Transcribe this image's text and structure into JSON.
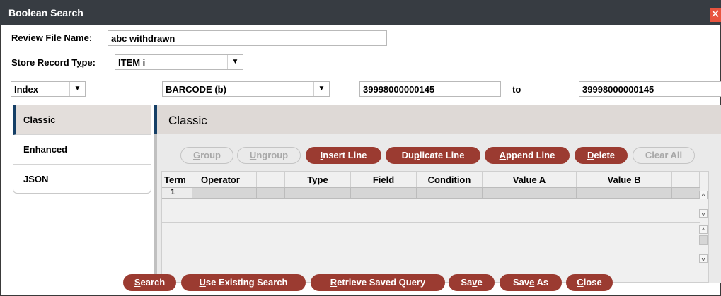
{
  "window": {
    "title": "Boolean Search",
    "close_glyph": "✕"
  },
  "review_file": {
    "label_prefix": "Revi",
    "label_mnemonic": "e",
    "label_suffix": "w File Name:",
    "value": "abc withdrawn"
  },
  "store_record": {
    "label_prefix": "Store Record T",
    "label_mnemonic": "y",
    "label_suffix": "pe:",
    "value": "ITEM i"
  },
  "index_select": {
    "value": "Index"
  },
  "field_select": {
    "value": "BARCODE  (b)"
  },
  "range": {
    "from": "39998000000145",
    "to_label": "to",
    "to": "39998000000145"
  },
  "tabs": [
    {
      "label": "Classic",
      "active": true
    },
    {
      "label": "Enhanced",
      "active": false
    },
    {
      "label": "JSON",
      "active": false
    }
  ],
  "panel": {
    "title": "Classic"
  },
  "toolbar": {
    "group": {
      "mn": "G",
      "rest": "roup"
    },
    "ungroup": {
      "mn": "U",
      "rest": "ngroup"
    },
    "insert": {
      "mn": "I",
      "rest": "nsert Line"
    },
    "duplicate": {
      "pre": "Du",
      "mn": "p",
      "rest": "licate Line"
    },
    "append": {
      "mn": "A",
      "rest": "ppend Line"
    },
    "delete": {
      "mn": "D",
      "rest": "elete"
    },
    "clear": {
      "label": "Clear All"
    }
  },
  "grid": {
    "columns": [
      "Term",
      "Operator",
      "Type",
      "Field",
      "Condition",
      "Value A",
      "Value B"
    ],
    "rows": [
      {
        "term": "1"
      }
    ]
  },
  "footer": {
    "search": {
      "mn": "S",
      "rest": "earch"
    },
    "use_existing": {
      "mn": "U",
      "rest": "se Existing Search"
    },
    "retrieve": {
      "mn": "R",
      "rest": "etrieve Saved Query"
    },
    "save": {
      "pre": "Sa",
      "mn": "v",
      "rest": "e"
    },
    "save_as": {
      "pre": "Sav",
      "mn": "e",
      "rest": " As"
    },
    "close": {
      "mn": "C",
      "rest": "lose"
    }
  },
  "colors": {
    "accent": "#9b3b31",
    "titlebar": "#373c42",
    "tab_marker": "#153f66"
  },
  "icons": {
    "dropdown": "▼",
    "scroll_up": "^",
    "scroll_down": "v"
  }
}
